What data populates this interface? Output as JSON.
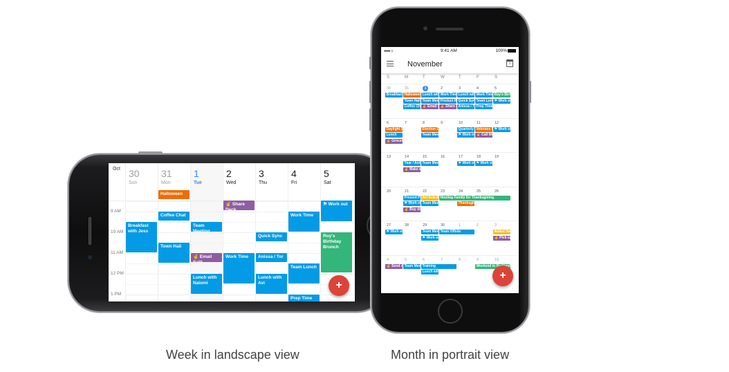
{
  "captions": {
    "landscape": "Week in landscape view",
    "portrait": "Month in portrait view"
  },
  "colors": {
    "event_blue": "#039be5",
    "event_orange": "#ef6c00",
    "event_purple": "#8e5ea2",
    "event_green": "#33b679",
    "event_yellow": "#f6bf26",
    "today_blue": "#4285f4",
    "fab_red": "#db4437"
  },
  "week_view": {
    "month_label": "Oct",
    "days": [
      {
        "num": "30",
        "dow": "Sun",
        "state": "past"
      },
      {
        "num": "31",
        "dow": "Mon",
        "state": "past"
      },
      {
        "num": "1",
        "dow": "Tue",
        "state": "today"
      },
      {
        "num": "2",
        "dow": "Wed",
        "state": "normal"
      },
      {
        "num": "3",
        "dow": "Thu",
        "state": "normal"
      },
      {
        "num": "4",
        "dow": "Fri",
        "state": "normal"
      },
      {
        "num": "5",
        "dow": "Sat",
        "state": "normal"
      }
    ],
    "hours": [
      "9 AM",
      "10 AM",
      "11 AM",
      "12 PM",
      "1 PM"
    ],
    "all_day_events": [
      {
        "day": 1,
        "title": "Halloween",
        "color": "orange"
      }
    ],
    "events": [
      {
        "day": 0,
        "title": "Breakfast with Jess",
        "color": "blue",
        "icon": ""
      },
      {
        "day": 1,
        "title": "Coffee Chat",
        "color": "blue",
        "icon": ""
      },
      {
        "day": 1,
        "title": "Town Hall",
        "color": "blue",
        "icon": ""
      },
      {
        "day": 2,
        "title": "Team Meeting",
        "color": "blue",
        "icon": ""
      },
      {
        "day": 2,
        "title": "Email Salit",
        "color": "purple",
        "icon": "reminder-hand-icon"
      },
      {
        "day": 2,
        "title": "Lunch with Naiomi",
        "color": "blue",
        "icon": ""
      },
      {
        "day": 3,
        "title": "Share Deck",
        "color": "purple",
        "icon": "reminder-hand-icon"
      },
      {
        "day": 3,
        "title": "Work Time",
        "color": "blue",
        "icon": ""
      },
      {
        "day": 4,
        "title": "Quick Sync",
        "color": "blue",
        "icon": ""
      },
      {
        "day": 4,
        "title": "Anissa / Tor",
        "color": "blue",
        "icon": ""
      },
      {
        "day": 4,
        "title": "Lunch with Avi",
        "color": "blue",
        "icon": ""
      },
      {
        "day": 5,
        "title": "Work Time",
        "color": "blue",
        "icon": ""
      },
      {
        "day": 5,
        "title": "Team Lunch",
        "color": "blue",
        "icon": ""
      },
      {
        "day": 5,
        "title": "Prep Time",
        "color": "blue",
        "icon": ""
      },
      {
        "day": 6,
        "title": "Work out",
        "color": "blue",
        "icon": "flag-icon"
      },
      {
        "day": 6,
        "title": "Roy's Birthday Brunch",
        "color": "green",
        "icon": ""
      }
    ],
    "fab_label": "+"
  },
  "month_view": {
    "status_bar": {
      "signal": "•••••",
      "wifi": "wifi-icon",
      "time": "9:41 AM",
      "battery": "100%"
    },
    "title": "November",
    "today_button_label": "1",
    "weekday_headers": [
      "S",
      "M",
      "T",
      "W",
      "T",
      "F",
      "S"
    ],
    "weeks": [
      {
        "dates": [
          "30",
          "31",
          "1",
          "2",
          "3",
          "4",
          "5"
        ],
        "other_month": [
          true,
          true,
          false,
          false,
          false,
          false,
          false
        ],
        "today_index": 2,
        "events": [
          {
            "col": 0,
            "row": 0,
            "span": 1,
            "title": "Breakfast with Jess",
            "color": "blue"
          },
          {
            "col": 1,
            "row": 0,
            "span": 1,
            "title": "Halloween",
            "color": "orange"
          },
          {
            "col": 1,
            "row": 1,
            "span": 1,
            "title": "Town Hall",
            "color": "blue"
          },
          {
            "col": 1,
            "row": 2,
            "span": 1,
            "title": "Coffee Chat",
            "color": "blue"
          },
          {
            "col": 2,
            "row": 0,
            "span": 1,
            "title": "Lunch with Naiomi",
            "color": "blue"
          },
          {
            "col": 2,
            "row": 1,
            "span": 1,
            "title": "Team Meeting",
            "color": "blue"
          },
          {
            "col": 2,
            "row": 2,
            "span": 1,
            "title": "☝ Email Salit",
            "color": "purple"
          },
          {
            "col": 3,
            "row": 0,
            "span": 1,
            "title": "Work Time",
            "color": "blue"
          },
          {
            "col": 3,
            "row": 1,
            "span": 1,
            "title": "Product Review",
            "color": "blue"
          },
          {
            "col": 3,
            "row": 2,
            "span": 1,
            "title": "☝ Share Deck",
            "color": "purple"
          },
          {
            "col": 4,
            "row": 0,
            "span": 1,
            "title": "Lunch with Avi",
            "color": "blue"
          },
          {
            "col": 4,
            "row": 1,
            "span": 1,
            "title": "Quick Sync",
            "color": "blue"
          },
          {
            "col": 4,
            "row": 2,
            "span": 1,
            "title": "Anissa / Tor",
            "color": "blue"
          },
          {
            "col": 5,
            "row": 0,
            "span": 1,
            "title": "Work Time",
            "color": "blue"
          },
          {
            "col": 5,
            "row": 1,
            "span": 1,
            "title": "Team Lunch",
            "color": "blue"
          },
          {
            "col": 5,
            "row": 2,
            "span": 1,
            "title": "Prep Time",
            "color": "blue"
          },
          {
            "col": 6,
            "row": 0,
            "span": 1,
            "title": "Roy's Birthday Brunch",
            "color": "green"
          },
          {
            "col": 6,
            "row": 1,
            "span": 1,
            "title": "⚑ Work out",
            "color": "blue"
          }
        ]
      },
      {
        "dates": [
          "6",
          "7",
          "8",
          "9",
          "10",
          "11",
          "12"
        ],
        "other_month": [
          false,
          false,
          false,
          false,
          false,
          false,
          false
        ],
        "today_index": -1,
        "events": [
          {
            "col": 0,
            "row": 0,
            "span": 1,
            "title": "Daylight Saving",
            "color": "orange"
          },
          {
            "col": 0,
            "row": 1,
            "span": 1,
            "title": "Lunch",
            "color": "blue"
          },
          {
            "col": 0,
            "row": 2,
            "span": 1,
            "title": "☝ Groceries",
            "color": "purple"
          },
          {
            "col": 2,
            "row": 0,
            "span": 1,
            "title": "Election Day",
            "color": "orange"
          },
          {
            "col": 2,
            "row": 1,
            "span": 1,
            "title": "Team Meeting",
            "color": "blue"
          },
          {
            "col": 4,
            "row": 0,
            "span": 1,
            "title": "Quarterly Review",
            "color": "blue"
          },
          {
            "col": 4,
            "row": 1,
            "span": 1,
            "title": "⚑ Work out",
            "color": "blue"
          },
          {
            "col": 5,
            "row": 0,
            "span": 1,
            "title": "Veterans Day",
            "color": "orange"
          },
          {
            "col": 5,
            "row": 1,
            "span": 1,
            "title": "☝ Call Mom",
            "color": "purple"
          },
          {
            "col": 6,
            "row": 0,
            "span": 1,
            "title": "⚑ Work out",
            "color": "blue"
          }
        ]
      },
      {
        "dates": [
          "13",
          "14",
          "15",
          "16",
          "17",
          "18",
          "19"
        ],
        "other_month": [
          false,
          false,
          false,
          false,
          false,
          false,
          false
        ],
        "today_index": -1,
        "events": [
          {
            "col": 1,
            "row": 0,
            "span": 1,
            "title": "Yaar / Anissa",
            "color": "blue"
          },
          {
            "col": 1,
            "row": 1,
            "span": 1,
            "title": "☝ Make a",
            "color": "purple"
          },
          {
            "col": 2,
            "row": 0,
            "span": 1,
            "title": "Team Meeting",
            "color": "blue"
          },
          {
            "col": 4,
            "row": 0,
            "span": 1,
            "title": "⚑ Work out",
            "color": "blue"
          },
          {
            "col": 5,
            "row": 0,
            "span": 1,
            "title": "⚑ Work out",
            "color": "blue"
          }
        ]
      },
      {
        "dates": [
          "20",
          "21",
          "22",
          "23",
          "24",
          "25",
          "26"
        ],
        "other_month": [
          false,
          false,
          false,
          false,
          false,
          false,
          false
        ],
        "today_index": -1,
        "events": [
          {
            "col": 1,
            "row": 0,
            "span": 1,
            "title": "Present Project",
            "color": "blue"
          },
          {
            "col": 1,
            "row": 1,
            "span": 1,
            "title": "⚑ Work out",
            "color": "blue"
          },
          {
            "col": 1,
            "row": 2,
            "span": 1,
            "title": "☝ Buy doughnuts",
            "color": "purple"
          },
          {
            "col": 2,
            "row": 0,
            "span": 1,
            "title": "Avi Sela B",
            "color": "yellow"
          },
          {
            "col": 2,
            "row": 1,
            "span": 1,
            "title": "Team Meeting",
            "color": "blue"
          },
          {
            "col": 3,
            "row": 0,
            "span": 4,
            "title": "Hosting Family for Thanksgiving",
            "color": "green"
          },
          {
            "col": 4,
            "row": 1,
            "span": 1,
            "title": "Thanksgiving",
            "color": "orange"
          }
        ]
      },
      {
        "dates": [
          "27",
          "28",
          "29",
          "30",
          "1",
          "2",
          "3"
        ],
        "other_month": [
          false,
          false,
          false,
          false,
          true,
          true,
          true
        ],
        "today_index": -1,
        "events": [
          {
            "col": 0,
            "row": 0,
            "span": 1,
            "title": "⚑ Work out",
            "color": "blue"
          },
          {
            "col": 2,
            "row": 0,
            "span": 1,
            "title": "Team Meeting",
            "color": "blue"
          },
          {
            "col": 2,
            "row": 1,
            "span": 1,
            "title": "⚑ Work out",
            "color": "blue"
          },
          {
            "col": 3,
            "row": 0,
            "span": 2,
            "title": "Team Offsite",
            "color": "blue"
          },
          {
            "col": 6,
            "row": 0,
            "span": 1,
            "title": "Aniket Vacation",
            "color": "yellow"
          },
          {
            "col": 6,
            "row": 1,
            "span": 1,
            "title": "☝ Pick up",
            "color": "purple"
          }
        ]
      },
      {
        "dates": [
          "4",
          "5",
          "6",
          "7",
          "8",
          "9",
          "10"
        ],
        "other_month": [
          true,
          true,
          true,
          true,
          true,
          true,
          true
        ],
        "today_index": -1,
        "events": [
          {
            "col": 0,
            "row": 0,
            "span": 1,
            "title": "☝ Send card",
            "color": "purple"
          },
          {
            "col": 1,
            "row": 0,
            "span": 1,
            "title": "Team Meeting",
            "color": "blue"
          },
          {
            "col": 2,
            "row": 0,
            "span": 2,
            "title": "Training",
            "color": "blue"
          },
          {
            "col": 2,
            "row": 1,
            "span": 1,
            "title": "Lunch with",
            "color": "blue"
          },
          {
            "col": 5,
            "row": 0,
            "span": 2,
            "title": "Weekend in Portland",
            "color": "green"
          }
        ]
      }
    ],
    "fab_label": "+"
  }
}
